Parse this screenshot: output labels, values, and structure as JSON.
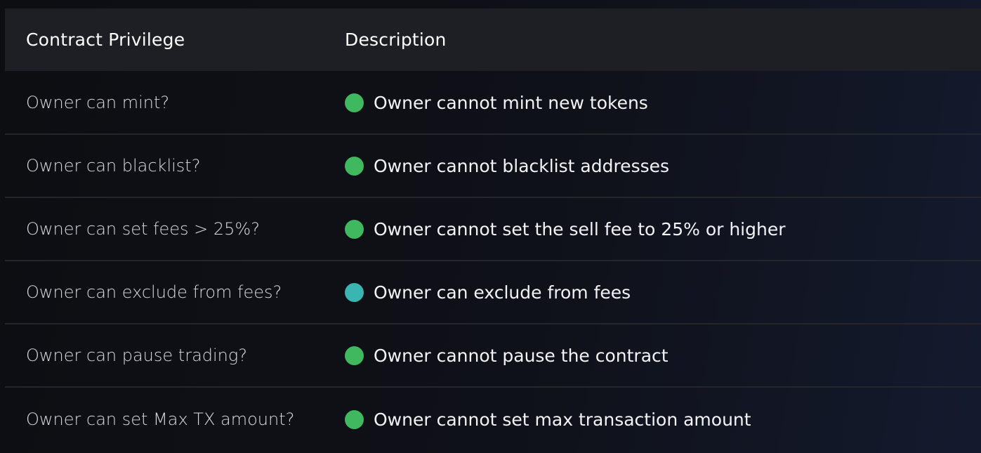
{
  "table": {
    "headers": {
      "privilege": "Contract Privilege",
      "description": "Description"
    },
    "rows": [
      {
        "privilege": "Owner can mint?",
        "description": "Owner cannot mint new tokens",
        "status_color": "#3fb85f"
      },
      {
        "privilege": "Owner can blacklist?",
        "description": "Owner cannot blacklist addresses",
        "status_color": "#3fb85f"
      },
      {
        "privilege": "Owner can set fees > 25%?",
        "description": "Owner cannot set the sell fee to 25% or higher",
        "status_color": "#3fb85f"
      },
      {
        "privilege": "Owner can exclude from fees?",
        "description": "Owner can exclude from fees",
        "status_color": "#3ab5b1"
      },
      {
        "privilege": "Owner can pause trading?",
        "description": "Owner cannot pause the contract",
        "status_color": "#3fb85f"
      },
      {
        "privilege": "Owner can set Max TX amount?",
        "description": "Owner cannot set max transaction amount",
        "status_color": "#3fb85f"
      }
    ]
  }
}
